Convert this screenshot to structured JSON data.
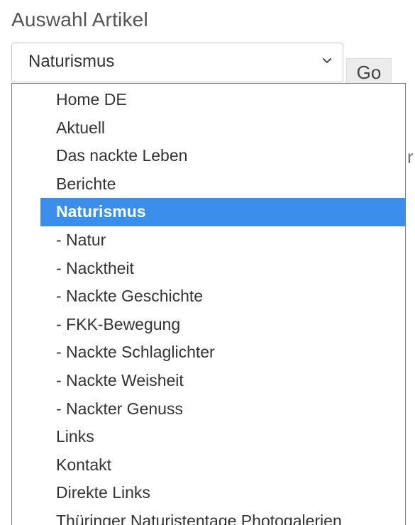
{
  "section": {
    "title": "Auswahl Artikel"
  },
  "select": {
    "value": "Naturismus",
    "chevron_icon": "chevron-down-icon"
  },
  "go_button": {
    "label": "Go"
  },
  "peek": {
    "text": "r"
  },
  "dropdown": {
    "selected_index": 4,
    "selected_color": "#3b8fec",
    "options": [
      "Home DE",
      "Aktuell",
      "Das nackte Leben",
      "Berichte",
      "Naturismus",
      "- Natur",
      "- Nacktheit",
      "- Nackte Geschichte",
      "- FKK-Bewegung",
      "- Nackte Schlaglichter",
      "- Nackte Weisheit",
      "- Nackter Genuss",
      "Links",
      "Kontakt",
      "Direkte Links",
      "Thüringer Naturistentage Photogalerien"
    ]
  }
}
